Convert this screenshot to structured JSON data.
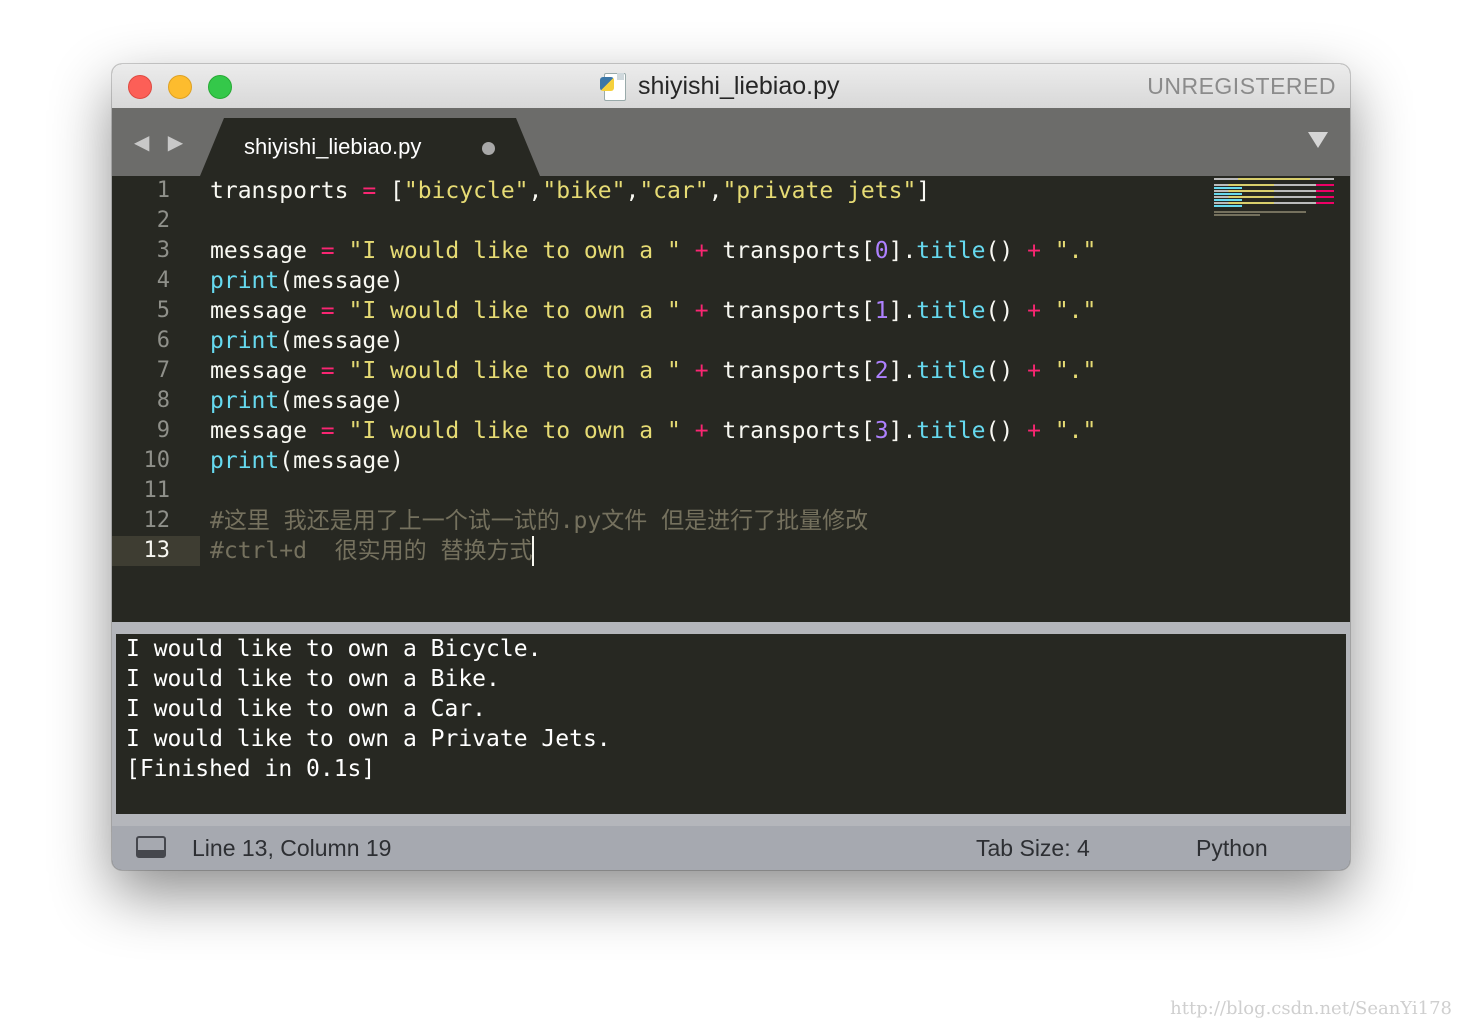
{
  "window": {
    "title": "shiyishi_liebiao.py",
    "unregistered_label": "UNREGISTERED",
    "file_icon": "python-file-icon"
  },
  "tabbar": {
    "nav_arrows": "◀ ▶",
    "active_tab": {
      "label": "shiyishi_liebiao.py",
      "modified_dot": true
    }
  },
  "editor": {
    "line_numbers": [
      "1",
      "2",
      "3",
      "4",
      "5",
      "6",
      "7",
      "8",
      "9",
      "10",
      "11",
      "12",
      "13"
    ],
    "active_line": 13,
    "lines": {
      "l1": {
        "a": "transports ",
        "b": "=",
        "c": " [",
        "d": "\"bicycle\"",
        "e": ",",
        "f": "\"bike\"",
        "g": ",",
        "h": "\"car\"",
        "i": ",",
        "j": "\"private jets\"",
        "k": "]"
      },
      "l3": {
        "a": "message ",
        "b": "=",
        "c": " ",
        "d": "\"I would like to own a \"",
        "e": " ",
        "f": "+",
        "g": " transports[",
        "h": "0",
        "i": "].",
        "j": "title",
        "k": "() ",
        "l": "+",
        "m": " ",
        "n": "\".\""
      },
      "l4": {
        "a": "print",
        "b": "(message)"
      },
      "l5": {
        "a": "message ",
        "b": "=",
        "c": " ",
        "d": "\"I would like to own a \"",
        "e": " ",
        "f": "+",
        "g": " transports[",
        "h": "1",
        "i": "].",
        "j": "title",
        "k": "() ",
        "l": "+",
        "m": " ",
        "n": "\".\""
      },
      "l6": {
        "a": "print",
        "b": "(message)"
      },
      "l7": {
        "a": "message ",
        "b": "=",
        "c": " ",
        "d": "\"I would like to own a \"",
        "e": " ",
        "f": "+",
        "g": " transports[",
        "h": "2",
        "i": "].",
        "j": "title",
        "k": "() ",
        "l": "+",
        "m": " ",
        "n": "\".\""
      },
      "l8": {
        "a": "print",
        "b": "(message)"
      },
      "l9": {
        "a": "message ",
        "b": "=",
        "c": " ",
        "d": "\"I would like to own a \"",
        "e": " ",
        "f": "+",
        "g": " transports[",
        "h": "3",
        "i": "].",
        "j": "title",
        "k": "() ",
        "l": "+",
        "m": " ",
        "n": "\".\""
      },
      "l10": {
        "a": "print",
        "b": "(message)"
      },
      "l12": "#这里 我还是用了上一个试一试的.py文件 但是进行了批量修改",
      "l13": "#ctrl+d  很实用的 替换方式"
    }
  },
  "output": {
    "lines": [
      "I would like to own a Bicycle.",
      "I would like to own a Bike.",
      "I would like to own a Car.",
      "I would like to own a Private Jets.",
      "[Finished in 0.1s]"
    ]
  },
  "statusbar": {
    "position": "Line 13, Column 19",
    "tab_size": "Tab Size: 4",
    "syntax": "Python",
    "panel_icon": "panel-toggle-icon"
  },
  "watermark": "http://blog.csdn.net/SeanYi178",
  "colors": {
    "editor_bg": "#272822",
    "keyword": "#f92672",
    "string": "#e6db74",
    "number": "#ae81ff",
    "function": "#66d9ef",
    "comment": "#75715e"
  }
}
